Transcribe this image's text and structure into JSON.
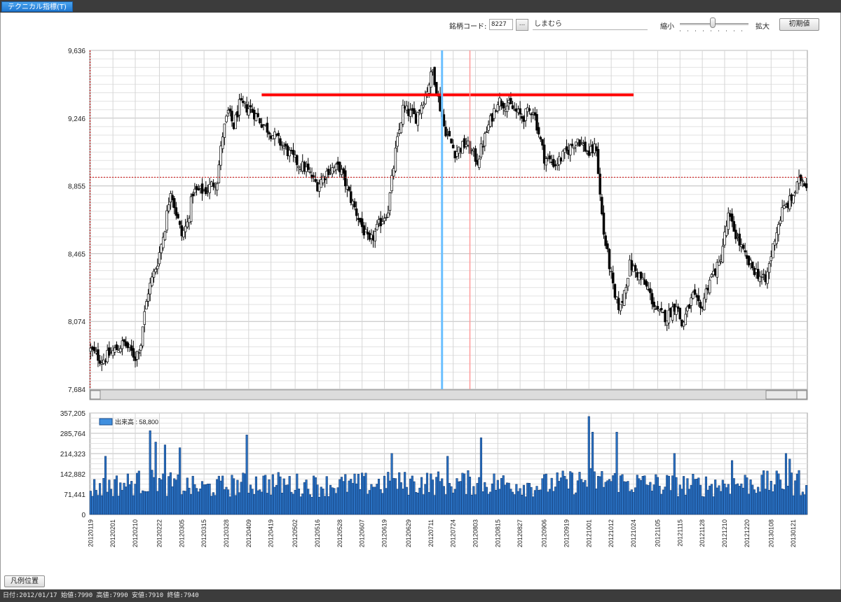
{
  "window": {
    "tab_label": "テクニカル指標(T)"
  },
  "toolbar": {
    "code_label": "銘柄コード:",
    "code_value": "8227",
    "browse_label": "...",
    "company_name": "しまむら",
    "zoom_out_label": "縮小",
    "zoom_in_label": "拡大",
    "zoom_level": 0.48,
    "reset_label": "初期値"
  },
  "legend_position_button": "凡例位置",
  "status_text": "日付:2012/01/17 始値:7990 高値:7990 安値:7910 終値:7940",
  "colors": {
    "volume_bar": "#2a72c4",
    "volume_legend": "#3f8fde",
    "resistance_line": "#ff0000",
    "cursor_line": "#6cc0ff",
    "reference_line": "#ff9a9a",
    "crosshair": "#cc0000"
  },
  "chart_data": [
    {
      "type": "candlestick",
      "y_ticks": [
        "9,636",
        "9,246",
        "8,855",
        "8,465",
        "8,074",
        "7,684"
      ],
      "ylim": [
        7684,
        9636
      ],
      "grid": true,
      "anchors": [
        [
          0,
          7910
        ],
        [
          6,
          7850
        ],
        [
          12,
          7900
        ],
        [
          18,
          7950
        ],
        [
          24,
          7870
        ],
        [
          27,
          7950
        ],
        [
          28,
          8050
        ],
        [
          31,
          8250
        ],
        [
          36,
          8420
        ],
        [
          40,
          8620
        ],
        [
          43,
          8840
        ],
        [
          46,
          8700
        ],
        [
          49,
          8570
        ],
        [
          52,
          8640
        ],
        [
          55,
          8820
        ],
        [
          62,
          8830
        ],
        [
          68,
          8890
        ],
        [
          71,
          9150
        ],
        [
          74,
          9280
        ],
        [
          77,
          9200
        ],
        [
          80,
          9320
        ],
        [
          86,
          9300
        ],
        [
          92,
          9220
        ],
        [
          98,
          9150
        ],
        [
          104,
          9080
        ],
        [
          110,
          9000
        ],
        [
          116,
          8950
        ],
        [
          122,
          8860
        ],
        [
          128,
          8950
        ],
        [
          134,
          8960
        ],
        [
          140,
          8780
        ],
        [
          146,
          8620
        ],
        [
          150,
          8520
        ],
        [
          156,
          8650
        ],
        [
          160,
          8720
        ],
        [
          164,
          9050
        ],
        [
          168,
          9300
        ],
        [
          175,
          9250
        ],
        [
          180,
          9380
        ],
        [
          184,
          9520
        ],
        [
          186,
          9420
        ],
        [
          190,
          9200
        ],
        [
          196,
          9050
        ],
        [
          202,
          9100
        ],
        [
          208,
          9000
        ],
        [
          214,
          9200
        ],
        [
          219,
          9350
        ],
        [
          226,
          9310
        ],
        [
          232,
          9250
        ],
        [
          238,
          9300
        ],
        [
          244,
          9020
        ],
        [
          250,
          8980
        ],
        [
          256,
          9050
        ],
        [
          262,
          9130
        ],
        [
          268,
          9040
        ],
        [
          272,
          9080
        ],
        [
          274,
          8800
        ],
        [
          276,
          8580
        ],
        [
          279,
          8400
        ],
        [
          282,
          8200
        ],
        [
          285,
          8150
        ],
        [
          290,
          8400
        ],
        [
          295,
          8340
        ],
        [
          300,
          8250
        ],
        [
          305,
          8120
        ],
        [
          310,
          8100
        ],
        [
          315,
          8180
        ],
        [
          318,
          8050
        ],
        [
          324,
          8220
        ],
        [
          328,
          8140
        ],
        [
          333,
          8320
        ],
        [
          338,
          8400
        ],
        [
          343,
          8680
        ],
        [
          348,
          8550
        ],
        [
          353,
          8420
        ],
        [
          358,
          8360
        ],
        [
          363,
          8300
        ],
        [
          368,
          8560
        ],
        [
          372,
          8710
        ],
        [
          377,
          8780
        ],
        [
          382,
          8900
        ],
        [
          385,
          8870
        ]
      ],
      "resistance_level": 9380,
      "crosshair_price": 8905,
      "cursor_date": "20120713",
      "x_ticks": [
        "20120119",
        "20120201",
        "20120210",
        "20120222",
        "20120305",
        "20120315",
        "20120328",
        "20120409",
        "20120419",
        "20120502",
        "20120516",
        "20120528",
        "20120607",
        "20120619",
        "20120629",
        "20120711",
        "20120724",
        "20120803",
        "20120815",
        "20120827",
        "20120906",
        "20120919",
        "20121001",
        "20121012",
        "20121024",
        "20121105",
        "20121115",
        "20121128",
        "20121210",
        "20121220",
        "20130108",
        "20130121"
      ]
    },
    {
      "type": "bar",
      "y_ticks": [
        "357,205",
        "285,764",
        "214,323",
        "142,882",
        "71,441",
        "0"
      ],
      "ylim": [
        0,
        357205
      ],
      "legend_label": "出来高 : 58,800",
      "legend_position": "top-left",
      "anchors": [
        [
          0,
          100000
        ],
        [
          30,
          125000
        ],
        [
          60,
          100000
        ],
        [
          90,
          120000
        ],
        [
          120,
          110000
        ],
        [
          150,
          115000
        ],
        [
          180,
          120000
        ],
        [
          210,
          120000
        ],
        [
          240,
          110000
        ],
        [
          270,
          130000
        ],
        [
          300,
          115000
        ],
        [
          330,
          110000
        ],
        [
          360,
          120000
        ],
        [
          385,
          115000
        ]
      ],
      "spikes": [
        [
          8,
          205000
        ],
        [
          32,
          295000
        ],
        [
          35,
          255000
        ],
        [
          40,
          245000
        ],
        [
          48,
          235000
        ],
        [
          84,
          280000
        ],
        [
          162,
          215000
        ],
        [
          192,
          205000
        ],
        [
          210,
          270000
        ],
        [
          268,
          345000
        ],
        [
          270,
          290000
        ],
        [
          283,
          290000
        ],
        [
          314,
          215000
        ],
        [
          345,
          190000
        ],
        [
          374,
          215000
        ],
        [
          376,
          195000
        ],
        [
          381,
          155000
        ]
      ]
    }
  ]
}
